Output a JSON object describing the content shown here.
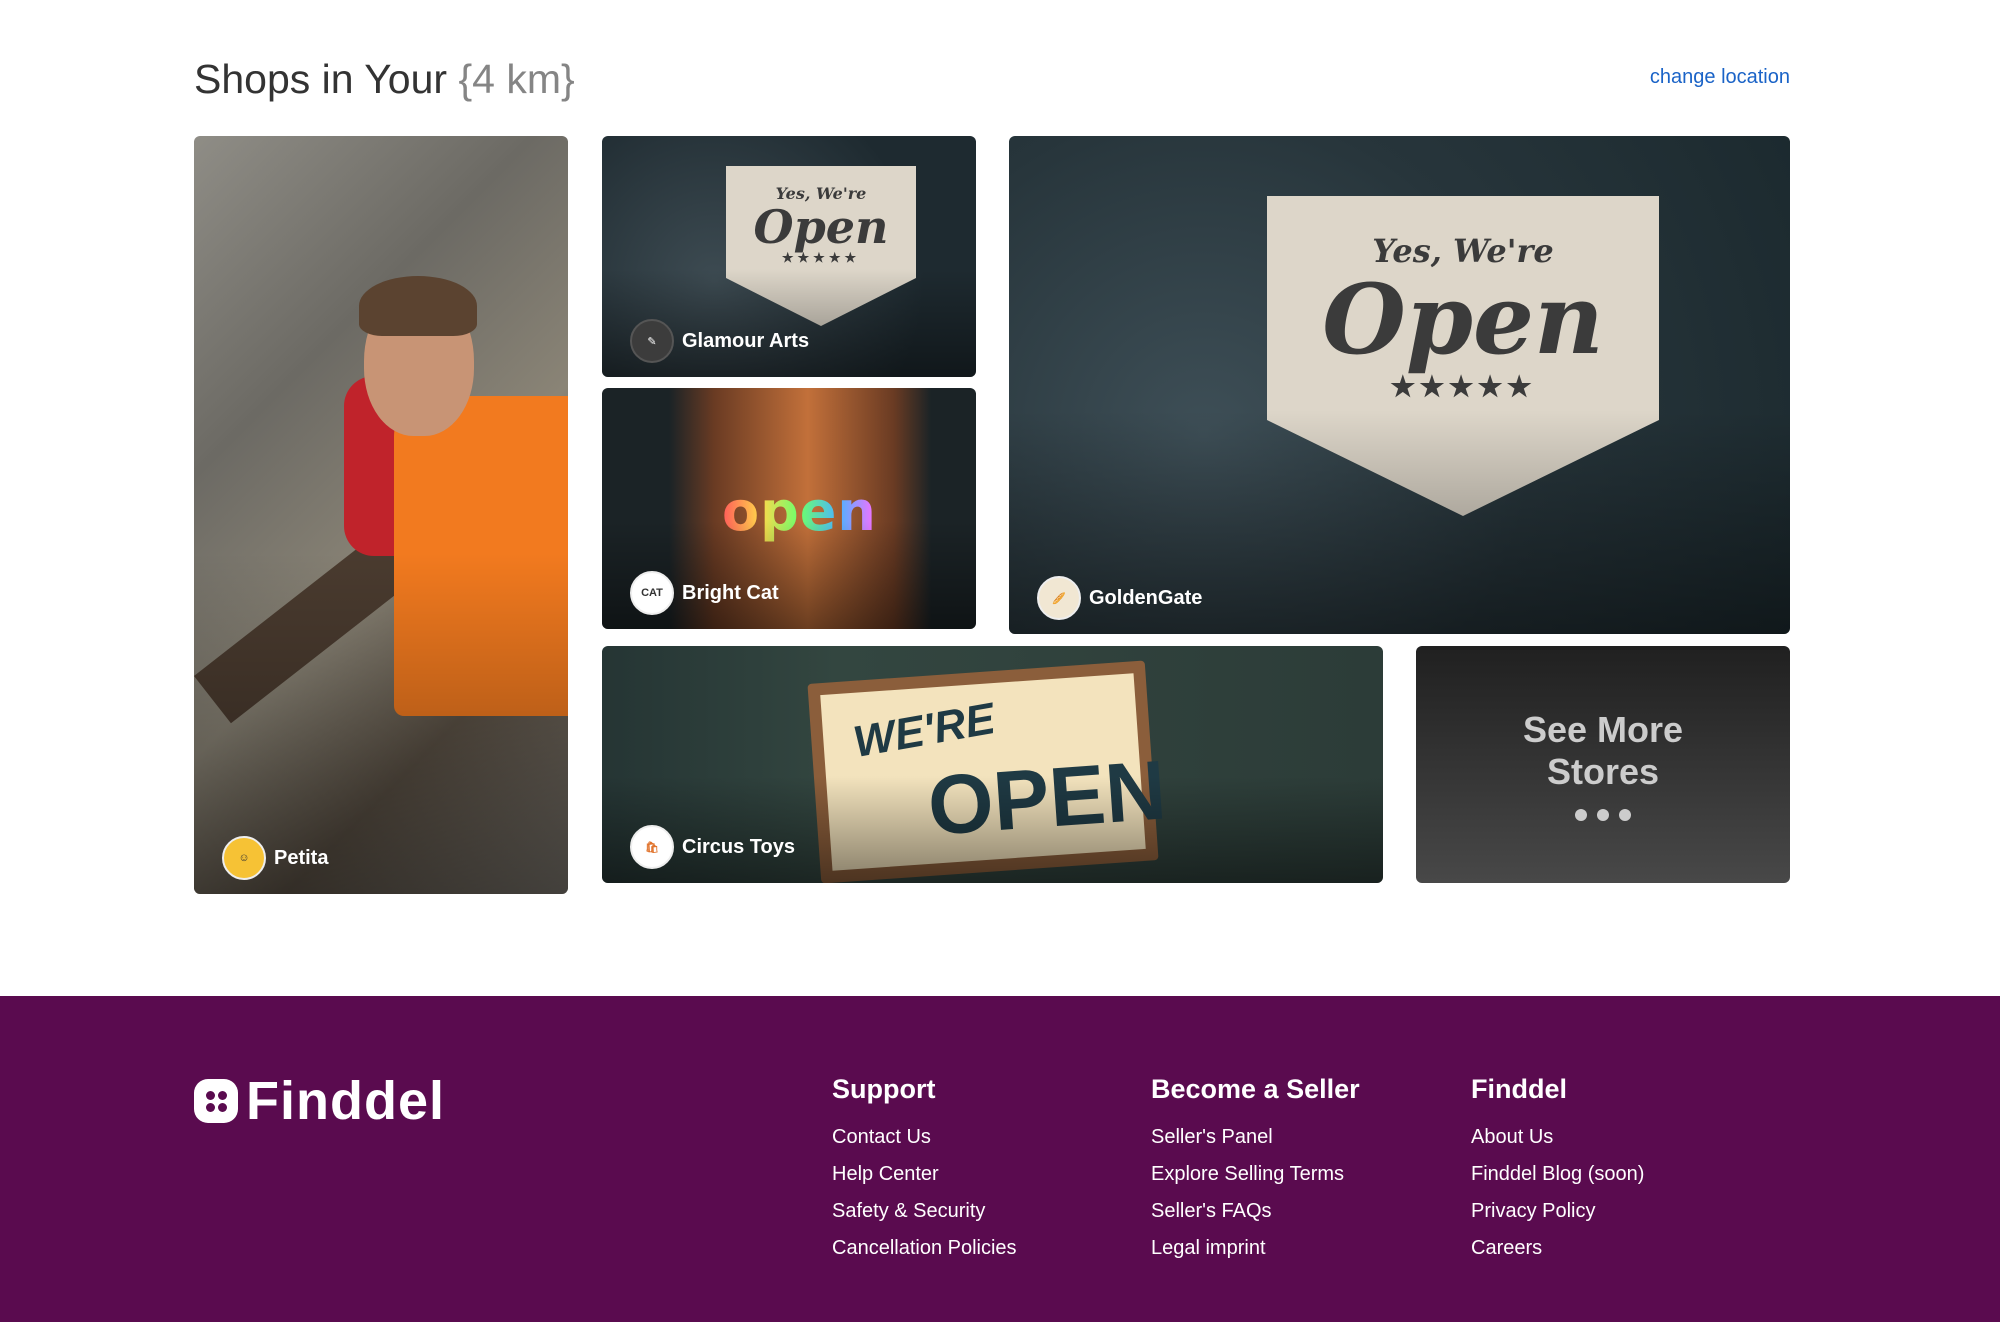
{
  "section": {
    "title_prefix": "Shops in Your ",
    "title_range": "{4 km}",
    "change_location": "change location"
  },
  "stores": [
    {
      "name": "Petita",
      "logo_icon": "chef-cartoon-logo"
    },
    {
      "name": "Glamour Arts",
      "logo_icon": "paint-brush-logo"
    },
    {
      "name": "Bright Cat",
      "logo_icon": "cat-badge-logo"
    },
    {
      "name": "GoldenGate",
      "logo_icon": "bread-logo"
    },
    {
      "name": "Circus Toys",
      "logo_icon": "toy-bag-logo"
    }
  ],
  "see_more": {
    "label": "See More Stores"
  },
  "footer": {
    "brand": "Finddel",
    "columns": [
      {
        "heading": "Support",
        "links": [
          "Contact Us",
          "Help Center",
          "Safety & Security",
          "Cancellation Policies"
        ]
      },
      {
        "heading": "Become a Seller",
        "links": [
          "Seller's Panel",
          "Explore Selling Terms",
          "Seller's FAQs",
          "Legal imprint"
        ]
      },
      {
        "heading": "Finddel",
        "links": [
          "About Us",
          "Finddel Blog (soon)",
          "Privacy Policy",
          "Careers"
        ]
      }
    ]
  },
  "colors": {
    "footer_bg": "#5a0b4f",
    "link_blue": "#1a63c7"
  }
}
